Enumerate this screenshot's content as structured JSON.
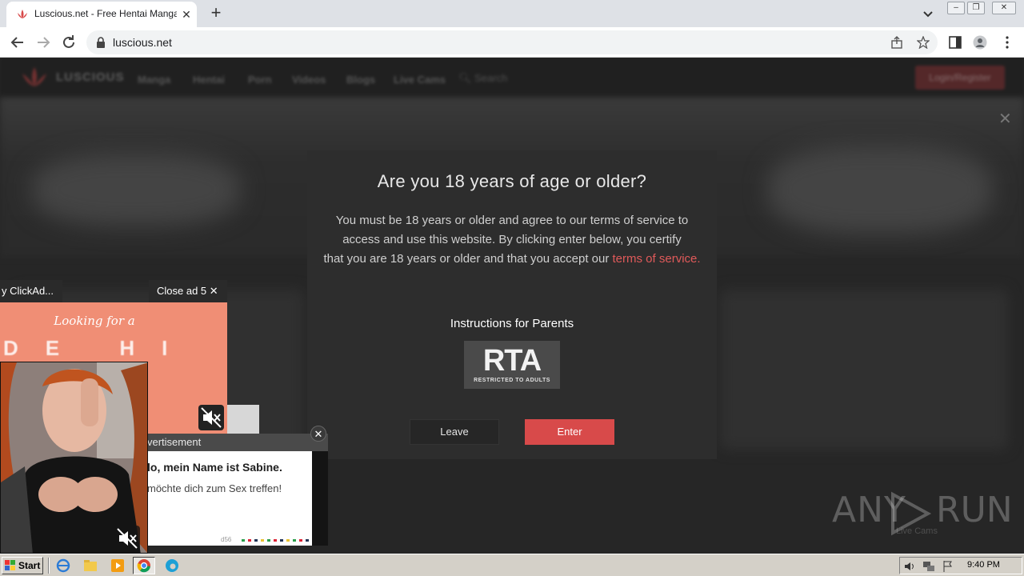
{
  "browser": {
    "tab_title": "Luscious.net - Free Hentai Manga, D",
    "tab_close": "✕",
    "new_tab": "+",
    "url": "luscious.net"
  },
  "site": {
    "logo_text": "LUSCIOUS",
    "nav": [
      "Manga",
      "Hentai",
      "Porn",
      "Videos",
      "Blogs",
      "Live Cams"
    ],
    "search_placeholder": "Search",
    "login_label": "Login/Register",
    "hero_close": "✕"
  },
  "modal": {
    "title": "Are you 18 years of age or older?",
    "body_line1": "You must be 18 years or older and agree to our terms of service to",
    "body_line2": "access and use this website. By clicking enter below, you certify",
    "body_line3": "that you are 18 years or older and that you accept our ",
    "body_link": "terms of service.",
    "parents_label": "Instructions for Parents",
    "rta_text": "RTA",
    "rta_sub": "RESTRICTED TO ADULTS",
    "leave_label": "Leave",
    "enter_label": "Enter"
  },
  "ads": {
    "label_bar": "y ClickAd...",
    "close_ad": "Close ad 5",
    "looking_for": "Looking for a",
    "big_letters": "DE HI",
    "advertisement": "vertisement",
    "popup_title": "lo, mein Name ist Sabine.",
    "popup_text": "möchte dich zum Sex treffen!",
    "popup_foot": "d56",
    "popup_close": "✕"
  },
  "watermark": {
    "any": "ANY",
    "run": "RUN",
    "sub": "Live Cams"
  },
  "taskbar": {
    "start_label": "Start",
    "clock": "9:40 PM"
  }
}
